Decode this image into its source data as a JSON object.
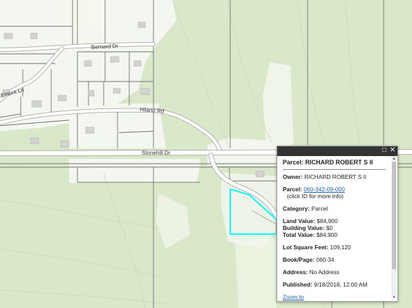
{
  "map": {
    "roads": {
      "bernard": "Bernard Dr",
      "elnora": "Elnora Ln",
      "hiland": "Hiland Rd",
      "stonehill": "Stonehill Dr"
    },
    "colors": {
      "background": "#d9e8c9",
      "parcel_line": "#6f6f6f",
      "road_fill": "#ffffff",
      "selection": "#00ffff"
    }
  },
  "popup": {
    "title": "Parcel: RICHARD ROBERT S II",
    "owner_label": "Owner:",
    "owner_value": "RICHARD ROBERT S II",
    "parcel_label": "Parcel:",
    "parcel_id": "060-342-09-000",
    "parcel_note": "(click ID for more info)",
    "category_label": "Category:",
    "category_value": "Parcel",
    "land_label": "Land Value:",
    "land_value": "$84,900",
    "building_label": "Building Value:",
    "building_value": "$0",
    "total_label": "Total Value:",
    "total_value": "$84,900",
    "lotsqft_label": "Lot Square Feet:",
    "lotsqft_value": "109,120",
    "bookpage_label": "Book/Page:",
    "bookpage_value": "060-34",
    "address_label": "Address:",
    "address_value": "No Address",
    "published_label": "Published:",
    "published_value": "9/18/2018, 12:00 AM",
    "zoom_link": "Zoom to",
    "maximize_icon": "maximize-icon",
    "close_icon": "close-icon"
  }
}
